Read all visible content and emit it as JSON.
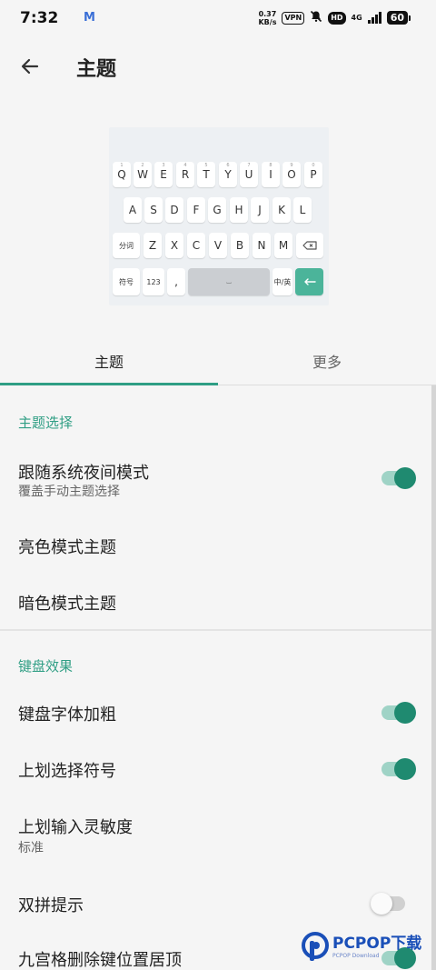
{
  "status_bar": {
    "time": "7:32",
    "mail_glyph": "M",
    "speed_value": "0.37",
    "speed_unit": "KB/s",
    "vpn": "VPN",
    "hd": "HD",
    "network": "4G",
    "battery": "60"
  },
  "app_bar": {
    "title": "主题"
  },
  "keyboard_preview": {
    "row1": [
      "Q",
      "W",
      "E",
      "R",
      "T",
      "Y",
      "U",
      "I",
      "O",
      "P"
    ],
    "row1_sub": [
      "1",
      "2",
      "3",
      "4",
      "5",
      "6",
      "7",
      "8",
      "9",
      "0"
    ],
    "row2": [
      "A",
      "S",
      "D",
      "F",
      "G",
      "H",
      "J",
      "K",
      "L"
    ],
    "row3_left": "分词",
    "row3": [
      "Z",
      "X",
      "C",
      "V",
      "B",
      "N",
      "M"
    ],
    "row4": {
      "symbols": "符号",
      "numbers": "123",
      "comma": ",",
      "space": "⌴",
      "lang": "中/英"
    }
  },
  "tabs": {
    "theme": "主题",
    "more": "更多"
  },
  "section_theme": {
    "header": "主题选择",
    "follow_system_title": "跟随系统夜间模式",
    "follow_system_sub": "覆盖手动主题选择",
    "light_theme": "亮色模式主题",
    "dark_theme": "暗色模式主题"
  },
  "section_keyboard": {
    "header": "键盘效果",
    "bold_font": "键盘字体加粗",
    "swipe_up_symbol": "上划选择符号",
    "swipe_sensitivity_title": "上划输入灵敏度",
    "swipe_sensitivity_value": "标准",
    "shuangpin_hint": "双拼提示",
    "nine_grid_delete_top": "九宫格删除键位置居顶"
  },
  "switches": {
    "follow_system": true,
    "bold_font": true,
    "swipe_up_symbol": true,
    "shuangpin_hint": false,
    "nine_grid_delete_top": true
  },
  "colors": {
    "accent": "#2f9e84",
    "switch_on_thumb": "#1f8a70",
    "switch_on_track": "#9fd3c6",
    "enter_key": "#4bb49a",
    "watermark_blue": "#1a4fb8"
  },
  "watermark": {
    "name": "PCPOP下载",
    "small": "PCPOP Download"
  }
}
